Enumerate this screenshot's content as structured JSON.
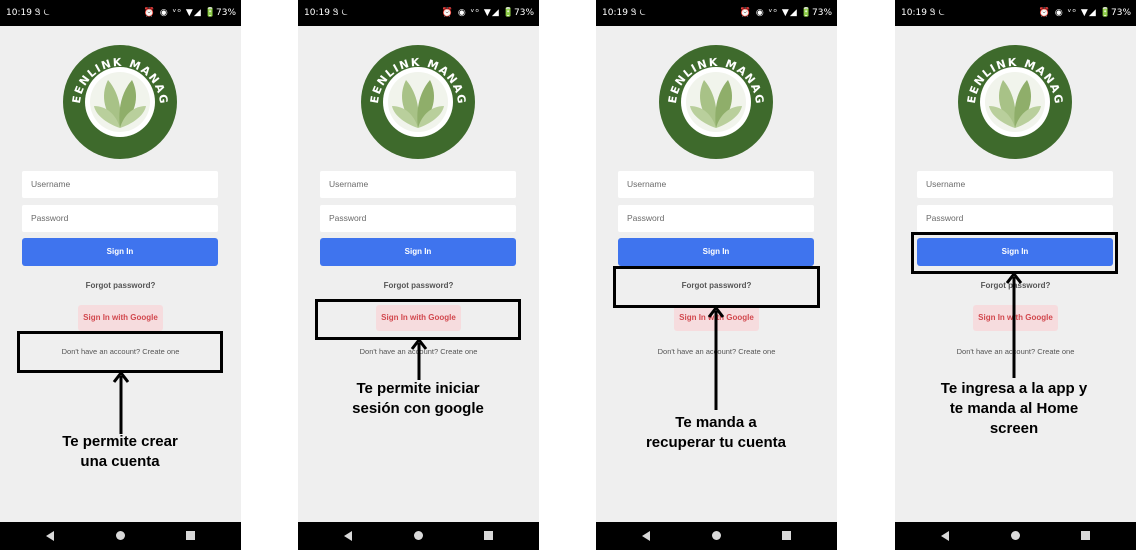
{
  "status_bar": {
    "time": "10:19",
    "left_icons": "Ꮥ ⏾",
    "right_icons": "⏰ ◉ ᵛᵒ ▼◢",
    "battery": "🔋73%"
  },
  "logo": {
    "text": "GREENLINK MANAGER",
    "ring_color": "#3e6a2c",
    "leaf_colors": [
      "#8fae6a",
      "#a8c287",
      "#b9cf9c"
    ]
  },
  "login_form": {
    "username_placeholder": "Username",
    "password_placeholder": "Password",
    "sign_in_label": "Sign In",
    "forgot_password_label": "Forgot password?",
    "google_sign_in_label": "Sign In with Google",
    "create_account_label": "Don't have an account? Create one"
  },
  "annotations": [
    {
      "lines": [
        "Te permite crear",
        "una cuenta"
      ]
    },
    {
      "lines": [
        "Te permite iniciar",
        "sesión con google"
      ]
    },
    {
      "lines": [
        "Te manda a",
        "recuperar tu cuenta"
      ]
    },
    {
      "lines": [
        "Te ingresa a la app y",
        "te manda al Home",
        "screen"
      ]
    }
  ],
  "colors": {
    "primary_button": "#3f74ee",
    "google_button_bg": "#f6dcde",
    "google_button_text": "#d2484e"
  }
}
